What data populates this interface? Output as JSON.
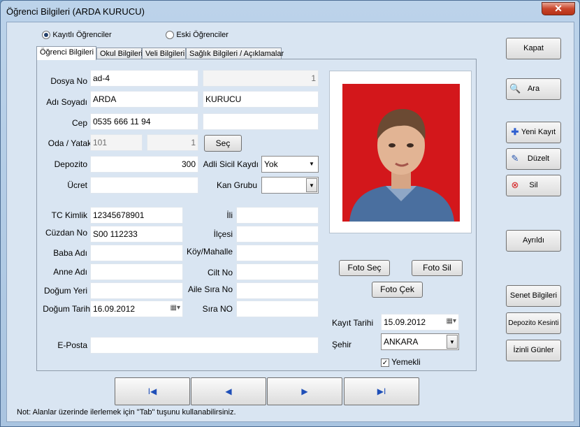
{
  "window": {
    "title": "Öğrenci Bilgileri (ARDA KURUCU)",
    "close_label": "✕"
  },
  "radios": {
    "opt1": "Kayıtlı Öğrenciler",
    "opt2": "Eski Öğrenciler"
  },
  "tabs": [
    "Öğrenci Bilgileri",
    "Okul Bilgileri",
    "Veli Bilgileri",
    "Sağlık Bilgileri / Açıklamalar"
  ],
  "form": {
    "dosya_no_label": "Dosya No",
    "dosya_no": "ad-4",
    "dosya_no_2": "1",
    "adi_soyadi_label": "Adı Soyadı",
    "adi": "ARDA",
    "soyadi": "KURUCU",
    "cep_label": "Cep",
    "cep": "0535 666 11 94",
    "cep_2": "",
    "oda_yatak_label": "Oda / Yatak",
    "oda": "101",
    "yatak": "1",
    "sec_button": "Seç",
    "depozito_label": "Depozito",
    "depozito": "300",
    "adli_sicil_label": "Adli Sicil Kaydı",
    "adli_sicil": "Yok",
    "ucret_label": "Ücret",
    "ucret": "",
    "kan_grubu_label": "Kan Grubu",
    "kan_grubu": "",
    "tc_label": "TC Kimlik",
    "tc": "12345678901",
    "ili_label": "İli",
    "ili": "",
    "cuzdan_label": "Cüzdan No",
    "cuzdan": "S00 112233",
    "ilcesi_label": "İlçesi",
    "ilcesi": "",
    "baba_label": "Baba Adı",
    "baba": "",
    "koy_label": "Köy/Mahalle",
    "koy": "",
    "anne_label": "Anne Adı",
    "anne": "",
    "cilt_label": "Cilt No",
    "cilt": "",
    "dogum_yeri_label": "Doğum Yeri",
    "dogum_yeri": "",
    "aile_sira_label": "Aile Sıra No",
    "aile_sira": "",
    "dogum_tarih_label": "Doğum Tarih",
    "dogum_tarih": "16.09.2012",
    "sira_label": "Sıra NO",
    "sira": "",
    "eposta_label": "E-Posta",
    "eposta": ""
  },
  "photo_buttons": {
    "foto_sec": "Foto Seç",
    "foto_sil": "Foto Sil",
    "foto_cek": "Foto Çek"
  },
  "kayit": {
    "tarih_label": "Kayıt Tarihi",
    "tarih": "15.09.2012",
    "sehir_label": "Şehir",
    "sehir": "ANKARA",
    "yemekli_label": "Yemekli",
    "yemekli_checked": true
  },
  "side_buttons": {
    "kapat": "Kapat",
    "ara": "Ara",
    "yeni_kayit": "Yeni Kayıt",
    "duzelt": "Düzelt",
    "sil": "Sil",
    "ayrildi": "Ayrıldı",
    "senet": "Senet Bilgileri",
    "depozito_kesinti": "Depozito Kesinti",
    "izinli": "İzinli Günler"
  },
  "nav": {
    "first": "I◀",
    "prev": "◀",
    "next": "▶",
    "last": "▶I"
  },
  "note": "Not: Alanlar üzerinde ilerlemek için \"Tab\" tuşunu kullanabilirsiniz."
}
